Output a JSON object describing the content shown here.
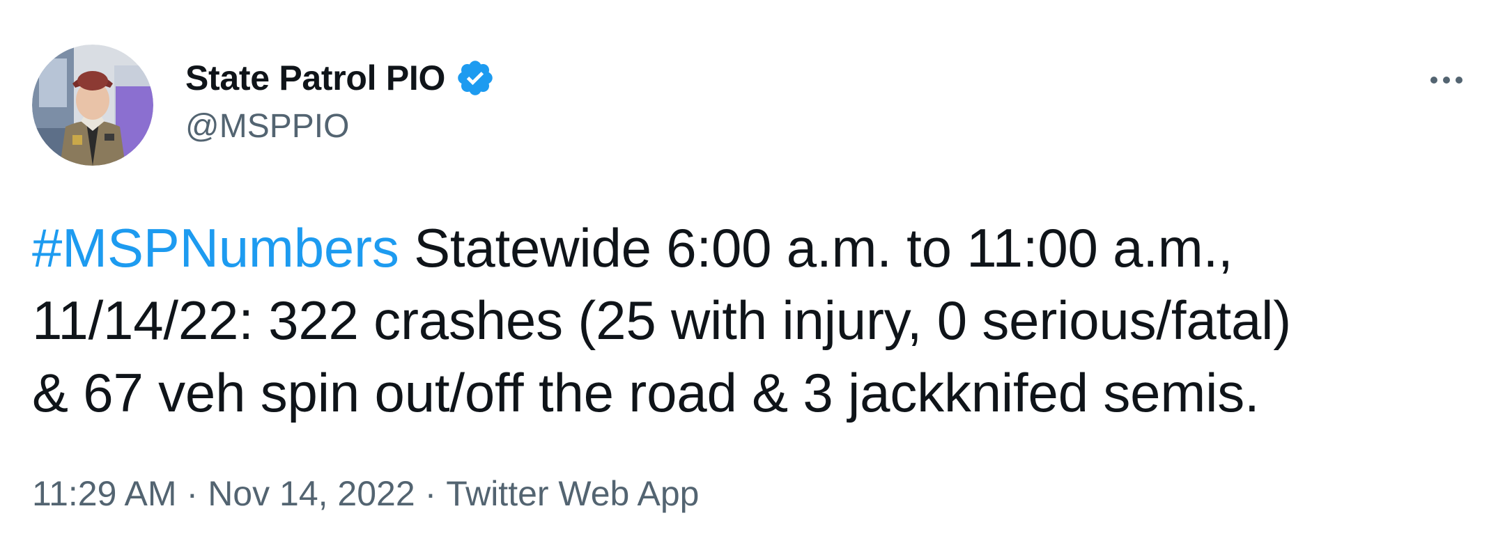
{
  "author": {
    "display_name": "State Patrol PIO",
    "handle": "@MSPPIO",
    "verified_icon": "verified-badge-icon",
    "verified_color": "#1d9bf0"
  },
  "more_menu": {
    "icon": "more-options-icon"
  },
  "tweet": {
    "hashtag": "#MSPNumbers",
    "line1_rest": " Statewide 6:00 a.m. to 11:00 a.m.,",
    "line2": "11/14/22: 322 crashes (25 with injury, 0 serious/fatal)",
    "line3": "& 67 veh spin out/off the road & 3 jackknifed semis.",
    "hashtag_color": "#1d9bf0"
  },
  "meta": {
    "time": "11:29 AM",
    "separator": "·",
    "date": "Nov 14, 2022",
    "source": "Twitter Web App"
  }
}
